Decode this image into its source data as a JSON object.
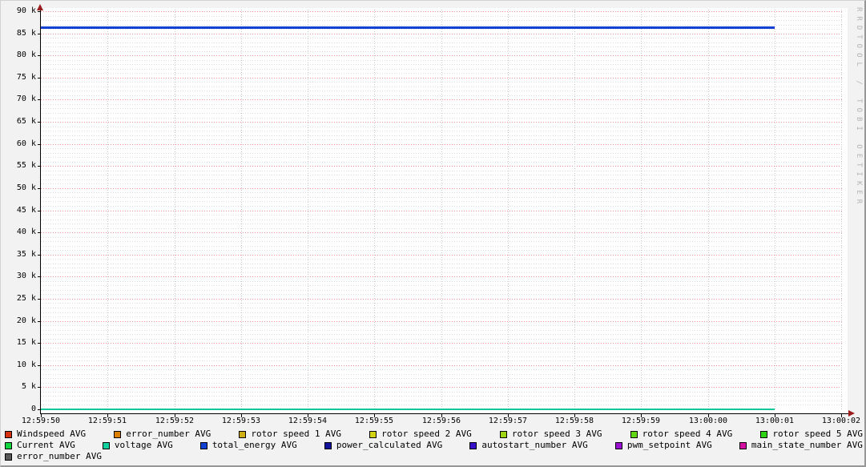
{
  "watermark": "RRDTOOL / TOBI OETIKER",
  "colors": {
    "outer_bg": "#f2f2f2",
    "plot_bg": "#ffffff",
    "axis": "#000000",
    "arrow": "#9b1d1d",
    "grid_major": "#ef8f8f",
    "grid_minor": "#dcdcdc",
    "grid_vertical": "#c8c8c8",
    "watermark_text": "#b4b4b4"
  },
  "chart_data": {
    "type": "line",
    "title": "",
    "xlabel": "",
    "ylabel": "",
    "grid": true,
    "legend_position": "bottom",
    "ylim": [
      0,
      90000
    ],
    "y_major_step": 5000,
    "y_minor_step": 1000,
    "y_tick_labels": [
      "0",
      "5 k",
      "10 k",
      "15 k",
      "20 k",
      "25 k",
      "30 k",
      "35 k",
      "40 k",
      "45 k",
      "50 k",
      "55 k",
      "60 k",
      "65 k",
      "70 k",
      "75 k",
      "80 k",
      "85 k",
      "90 k"
    ],
    "x_tick_labels": [
      "12:59:50",
      "12:59:51",
      "12:59:52",
      "12:59:53",
      "12:59:54",
      "12:59:55",
      "12:59:56",
      "12:59:57",
      "12:59:58",
      "12:59:59",
      "13:00:00",
      "13:00:01",
      "13:00:02"
    ],
    "data_start": "12:59:50",
    "data_end": "13:00:01",
    "series": [
      {
        "name": "Windspeed AVG",
        "color": "#d5310e",
        "avg": 0
      },
      {
        "name": "error_number AVG",
        "color": "#dd7e00",
        "avg": 0
      },
      {
        "name": "rotor speed 1 AVG",
        "color": "#cfae14",
        "avg": 0
      },
      {
        "name": "rotor speed 2 AVG",
        "color": "#d3d314",
        "avg": 0
      },
      {
        "name": "rotor speed 3 AVG",
        "color": "#9fd414",
        "avg": 0
      },
      {
        "name": "rotor speed 4 AVG",
        "color": "#63d614",
        "avg": 0
      },
      {
        "name": "rotor speed 5 AVG",
        "color": "#2ed314",
        "avg": 0
      },
      {
        "name": "Current AVG",
        "color": "#10d53e",
        "avg": 0
      },
      {
        "name": "voltage AVG",
        "color": "#12d3a0",
        "avg": 0
      },
      {
        "name": "total_energy AVG",
        "color": "#1140d2",
        "avg": 86400
      },
      {
        "name": "power_calculated AVG",
        "color": "#12129c",
        "avg": 0
      },
      {
        "name": "autostart_number AVG",
        "color": "#3712c9",
        "avg": 0
      },
      {
        "name": "pwm_setpoint AVG",
        "color": "#9a10d0",
        "avg": 0
      },
      {
        "name": "main_state_number AVG",
        "color": "#d310a1",
        "avg": 0
      },
      {
        "name": "error_number AVG",
        "color": "#5a5a5a",
        "avg": 0
      }
    ],
    "legend_rows": [
      7,
      7,
      1
    ],
    "visible_lines": [
      {
        "series": "voltage AVG",
        "value": 0,
        "color": "#10c79a",
        "from": "12:59:50",
        "to": "13:00:01",
        "thickness": 2
      },
      {
        "series": "total_energy AVG",
        "value": 86400,
        "color": "#1140d2",
        "from": "12:59:50",
        "to": "13:00:01",
        "thickness": 3
      }
    ]
  }
}
